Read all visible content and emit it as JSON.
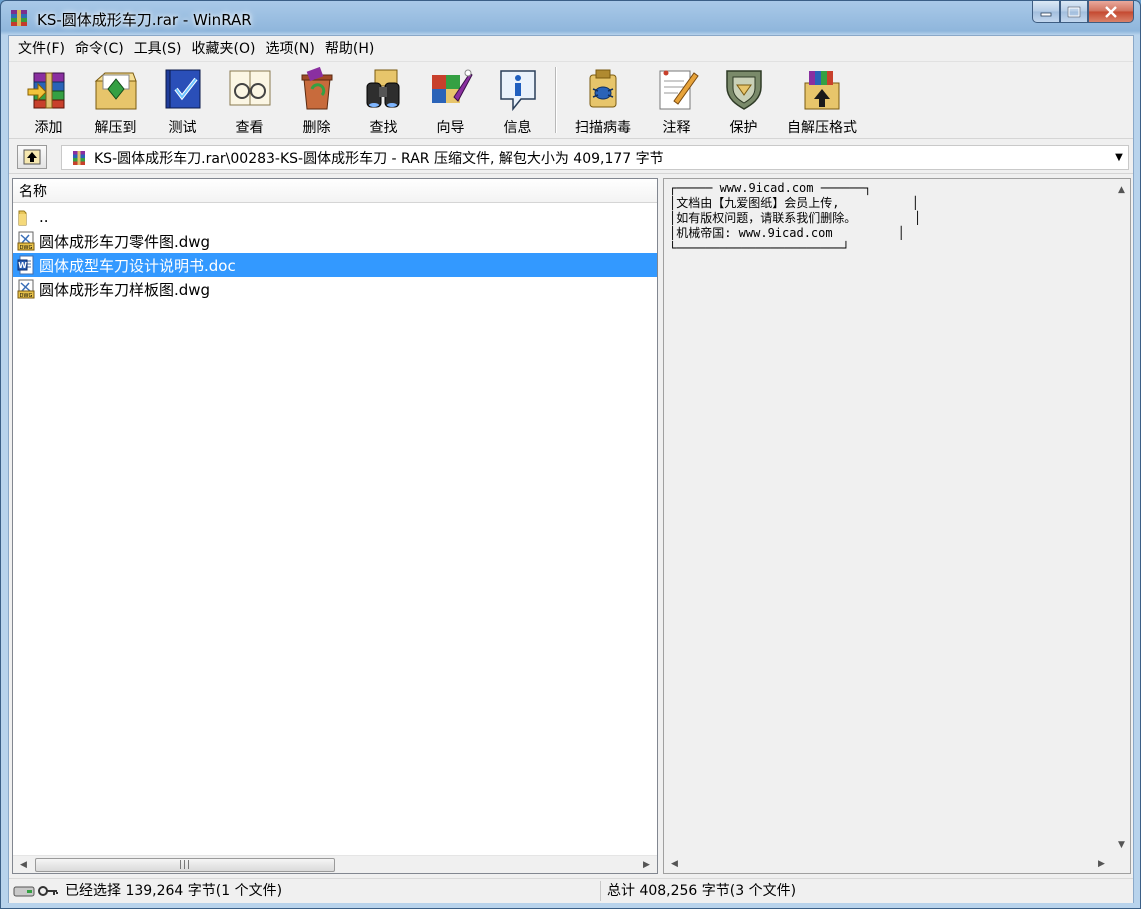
{
  "window": {
    "title": "KS-圆体成形车刀.rar - WinRAR",
    "controls": [
      "minimize",
      "maximize",
      "close"
    ]
  },
  "menubar": {
    "items": [
      {
        "label": "文件(F)"
      },
      {
        "label": "命令(C)"
      },
      {
        "label": "工具(S)"
      },
      {
        "label": "收藏夹(O)"
      },
      {
        "label": "选项(N)"
      },
      {
        "label": "帮助(H)"
      }
    ]
  },
  "toolbar": {
    "items": [
      {
        "label": "添加",
        "icon": "add-archive-icon"
      },
      {
        "label": "解压到",
        "icon": "extract-to-icon"
      },
      {
        "label": "测试",
        "icon": "test-icon"
      },
      {
        "label": "查看",
        "icon": "view-icon"
      },
      {
        "label": "删除",
        "icon": "delete-icon"
      },
      {
        "label": "查找",
        "icon": "find-icon"
      },
      {
        "label": "向导",
        "icon": "wizard-icon"
      },
      {
        "label": "信息",
        "icon": "info-icon"
      },
      {
        "label": "扫描病毒",
        "icon": "virus-scan-icon"
      },
      {
        "label": "注释",
        "icon": "comment-icon"
      },
      {
        "label": "保护",
        "icon": "protect-icon"
      },
      {
        "label": "自解压格式",
        "icon": "sfx-icon"
      }
    ]
  },
  "address": {
    "path": "KS-圆体成形车刀.rar\\00283-KS-圆体成形车刀 - RAR 压缩文件, 解包大小为 409,177 字节"
  },
  "file_list": {
    "column_name": "名称",
    "rows": [
      {
        "name": "..",
        "type": "parent-folder",
        "selected": false
      },
      {
        "name": "圆体成形车刀零件图.dwg",
        "type": "dwg",
        "selected": false
      },
      {
        "name": "圆体成型车刀设计说明书.doc",
        "type": "doc",
        "selected": true
      },
      {
        "name": "圆体成形车刀样板图.dwg",
        "type": "dwg",
        "selected": false
      }
    ]
  },
  "comment_pane": {
    "lines": [
      "┌───── www.9icad.com ──────┐",
      "│文档由【九爱图纸】会员上传,          │",
      "│如有版权问题，请联系我们删除。        │",
      "│机械帝国: www.9icad.com         │",
      "└───────────────────────┘"
    ]
  },
  "statusbar": {
    "selected_text": "已经选择 139,264 字节(1 个文件)",
    "total_text": "总计 408,256 字节(3 个文件)"
  },
  "colors": {
    "selection": "#3399ff",
    "title_gradient": "#a9c9e8"
  }
}
